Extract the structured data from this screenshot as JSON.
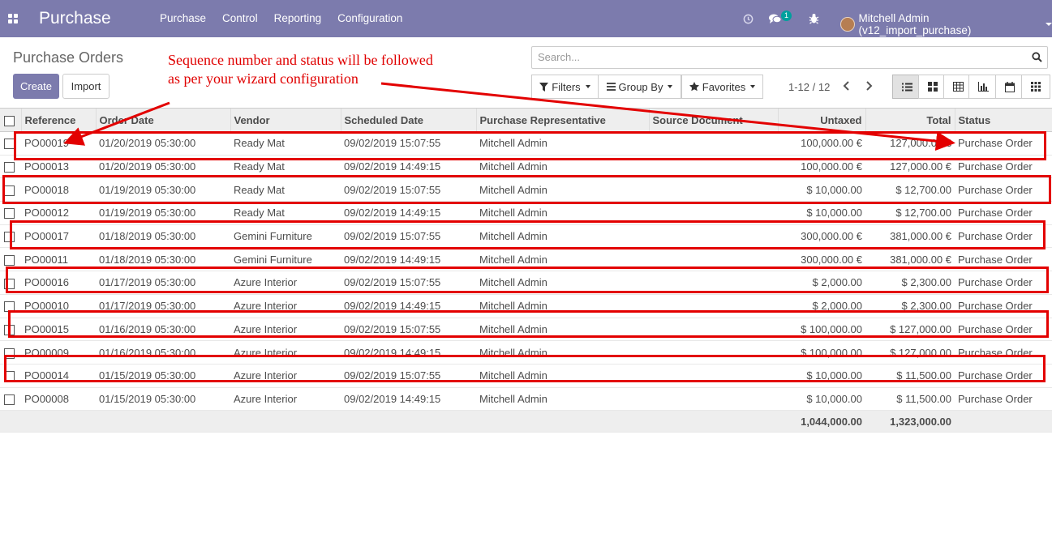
{
  "navbar": {
    "app_title": "Purchase",
    "menu": [
      "Purchase",
      "Control",
      "Reporting",
      "Configuration"
    ],
    "chat_badge": "1",
    "user": "Mitchell Admin (v12_import_purchase)"
  },
  "control": {
    "title": "Purchase Orders",
    "create_label": "Create",
    "import_label": "Import",
    "search_placeholder": "Search...",
    "filters_label": "Filters",
    "groupby_label": "Group By",
    "favorites_label": "Favorites",
    "pager": "1-12 / 12"
  },
  "annotation": {
    "line1": "Sequence number and status will be followed",
    "line2": "as per your wizard configuration"
  },
  "table": {
    "columns": [
      "Reference",
      "Order Date",
      "Vendor",
      "Scheduled Date",
      "Purchase Representative",
      "Source Document",
      "Untaxed",
      "Total",
      "Status"
    ],
    "rows": [
      [
        "PO00019",
        "01/20/2019 05:30:00",
        "Ready Mat",
        "09/02/2019 15:07:55",
        "Mitchell Admin",
        "",
        "100,000.00 €",
        "127,000.00 €",
        "Purchase Order"
      ],
      [
        "PO00013",
        "01/20/2019 05:30:00",
        "Ready Mat",
        "09/02/2019 14:49:15",
        "Mitchell Admin",
        "",
        "100,000.00 €",
        "127,000.00 €",
        "Purchase Order"
      ],
      [
        "PO00018",
        "01/19/2019 05:30:00",
        "Ready Mat",
        "09/02/2019 15:07:55",
        "Mitchell Admin",
        "",
        "$ 10,000.00",
        "$ 12,700.00",
        "Purchase Order"
      ],
      [
        "PO00012",
        "01/19/2019 05:30:00",
        "Ready Mat",
        "09/02/2019 14:49:15",
        "Mitchell Admin",
        "",
        "$ 10,000.00",
        "$ 12,700.00",
        "Purchase Order"
      ],
      [
        "PO00017",
        "01/18/2019 05:30:00",
        "Gemini Furniture",
        "09/02/2019 15:07:55",
        "Mitchell Admin",
        "",
        "300,000.00 €",
        "381,000.00 €",
        "Purchase Order"
      ],
      [
        "PO00011",
        "01/18/2019 05:30:00",
        "Gemini Furniture",
        "09/02/2019 14:49:15",
        "Mitchell Admin",
        "",
        "300,000.00 €",
        "381,000.00 €",
        "Purchase Order"
      ],
      [
        "PO00016",
        "01/17/2019 05:30:00",
        "Azure Interior",
        "09/02/2019 15:07:55",
        "Mitchell Admin",
        "",
        "$ 2,000.00",
        "$ 2,300.00",
        "Purchase Order"
      ],
      [
        "PO00010",
        "01/17/2019 05:30:00",
        "Azure Interior",
        "09/02/2019 14:49:15",
        "Mitchell Admin",
        "",
        "$ 2,000.00",
        "$ 2,300.00",
        "Purchase Order"
      ],
      [
        "PO00015",
        "01/16/2019 05:30:00",
        "Azure Interior",
        "09/02/2019 15:07:55",
        "Mitchell Admin",
        "",
        "$ 100,000.00",
        "$ 127,000.00",
        "Purchase Order"
      ],
      [
        "PO00009",
        "01/16/2019 05:30:00",
        "Azure Interior",
        "09/02/2019 14:49:15",
        "Mitchell Admin",
        "",
        "$ 100,000.00",
        "$ 127,000.00",
        "Purchase Order"
      ],
      [
        "PO00014",
        "01/15/2019 05:30:00",
        "Azure Interior",
        "09/02/2019 15:07:55",
        "Mitchell Admin",
        "",
        "$ 10,000.00",
        "$ 11,500.00",
        "Purchase Order"
      ],
      [
        "PO00008",
        "01/15/2019 05:30:00",
        "Azure Interior",
        "09/02/2019 14:49:15",
        "Mitchell Admin",
        "",
        "$ 10,000.00",
        "$ 11,500.00",
        "Purchase Order"
      ]
    ],
    "totals": {
      "untaxed": "1,044,000.00",
      "total": "1,323,000.00"
    }
  },
  "colors": {
    "brand": "#7c7bad",
    "annotation": "#e30000",
    "badge": "#00a09d"
  }
}
